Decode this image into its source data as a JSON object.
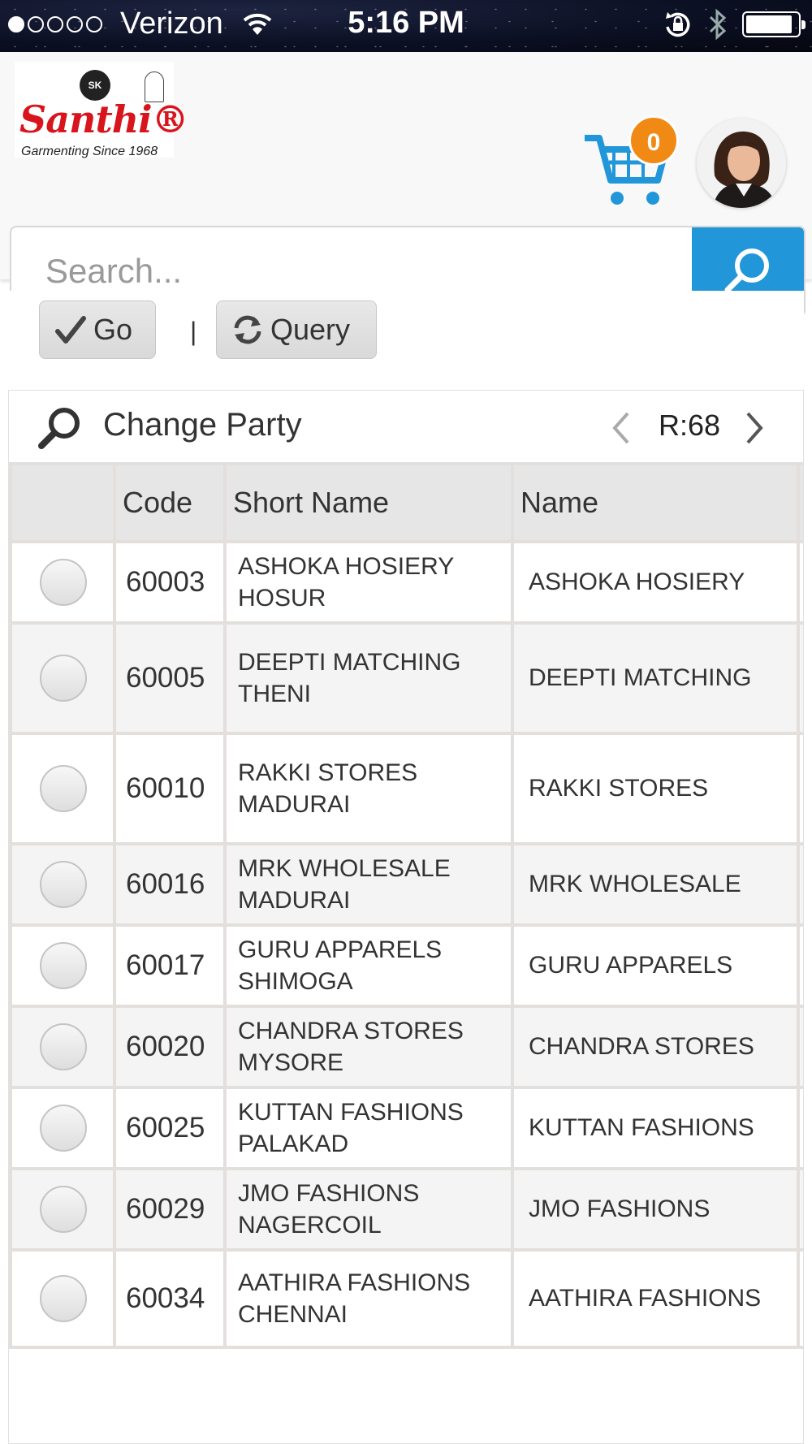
{
  "status_bar": {
    "carrier": "Verizon",
    "time": "5:16 PM",
    "signal_bars_filled": 1,
    "signal_bars_total": 5,
    "battery_level": 0.9
  },
  "header": {
    "logo": {
      "brand": "Santhi",
      "registered_mark": "®",
      "tagline": "Garmenting Since 1968",
      "emblem_text": "SK"
    },
    "cart_count": "0",
    "search": {
      "placeholder": "Search...",
      "value": ""
    }
  },
  "toolbar": {
    "go_label": "Go",
    "separator": "|",
    "query_label": "Query"
  },
  "grid": {
    "title": "Change Party",
    "record_label": "R:68",
    "columns": [
      "",
      "Code",
      "Short Name",
      "Name"
    ],
    "rows": [
      {
        "code": "60003",
        "short_name": [
          "ASHOKA HOSIERY",
          "HOSUR"
        ],
        "name": "ASHOKA HOSIERY"
      },
      {
        "code": "60005",
        "short_name": [
          "DEEPTI MATCHING",
          "THENI"
        ],
        "name": "DEEPTI MATCHING"
      },
      {
        "code": "60010",
        "short_name": [
          "RAKKI STORES",
          "MADURAI"
        ],
        "name": "RAKKI STORES"
      },
      {
        "code": "60016",
        "short_name": [
          "MRK WHOLESALE",
          "MADURAI"
        ],
        "name": "MRK WHOLESALE"
      },
      {
        "code": "60017",
        "short_name": [
          "GURU APPARELS",
          "SHIMOGA"
        ],
        "name": "GURU APPARELS"
      },
      {
        "code": "60020",
        "short_name": [
          "CHANDRA STORES",
          "MYSORE"
        ],
        "name": "CHANDRA STORES"
      },
      {
        "code": "60025",
        "short_name": [
          "KUTTAN FASHIONS",
          "PALAKAD"
        ],
        "name": "KUTTAN FASHIONS"
      },
      {
        "code": "60029",
        "short_name": [
          "JMO FASHIONS",
          "NAGERCOIL"
        ],
        "name": "JMO FASHIONS"
      },
      {
        "code": "60034",
        "short_name": [
          "AATHIRA FASHIONS",
          "CHENNAI"
        ],
        "name": "AATHIRA FASHIONS"
      }
    ]
  },
  "colors": {
    "search_button": "#2196d9",
    "cart_icon": "#2196d9",
    "cart_badge": "#f08a14",
    "brand_red": "#d8141c"
  },
  "icons": {
    "status": [
      "signal-dots",
      "wifi-icon",
      "rotation-lock-icon",
      "bluetooth-icon",
      "battery-icon"
    ],
    "header": [
      "cart-icon",
      "search-icon"
    ],
    "toolbar": [
      "checkmark-icon",
      "refresh-icon"
    ],
    "grid": [
      "magnifier-icon",
      "chevron-left-icon",
      "chevron-right-icon"
    ]
  }
}
